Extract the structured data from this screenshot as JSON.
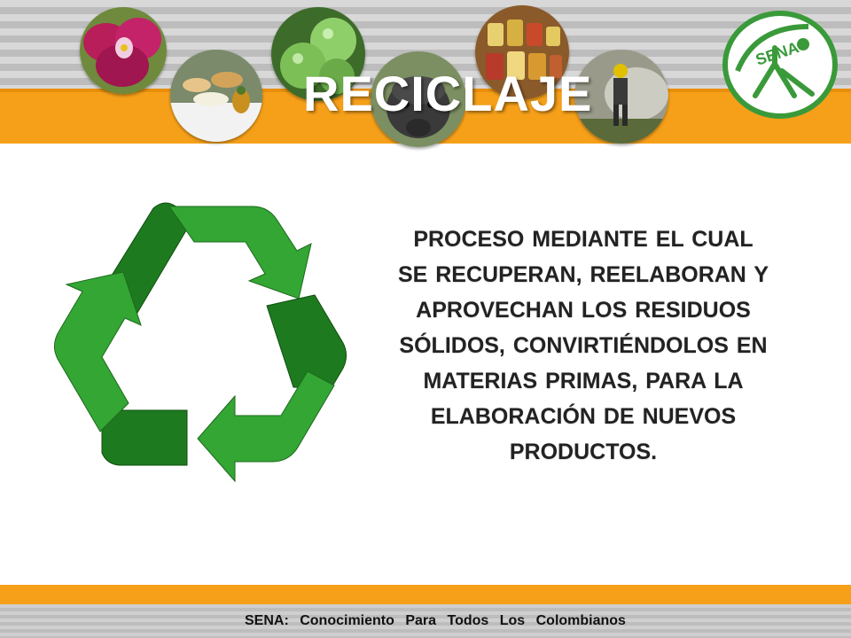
{
  "slide": {
    "title": "RECICLAJE",
    "definition": "PROCESO MEDIANTE EL CUAL SE RECUPERAN, REELABORAN Y APROVECHAN LOS RESIDUOS SÓLIDOS, CONVIRTIÉNDOLOS EN MATERIAS PRIMAS, PARA LA ELABORACIÓN DE NUEVOS PRODUCTOS.",
    "footer": "SENA:  Conocimiento  Para  Todos  Los  Colombianos"
  },
  "logo": {
    "text": "SENA",
    "color": "#3a9a3a"
  },
  "header_photos": [
    {
      "name": "flower-photo",
      "subject": "orchid"
    },
    {
      "name": "food-buffet-photo",
      "subject": "buffet"
    },
    {
      "name": "tomatoes-photo",
      "subject": "green tomatoes"
    },
    {
      "name": "buffalo-photo",
      "subject": "water buffalo"
    },
    {
      "name": "jars-photo",
      "subject": "preserved food jars"
    },
    {
      "name": "worker-photo",
      "subject": "worker with smoke"
    }
  ],
  "colors": {
    "orange": "#f6a01a",
    "dark_green": "#1e7a1e",
    "light_green": "#33a633",
    "text": "#222222"
  },
  "icons": {
    "recycle": "recycle-icon"
  }
}
